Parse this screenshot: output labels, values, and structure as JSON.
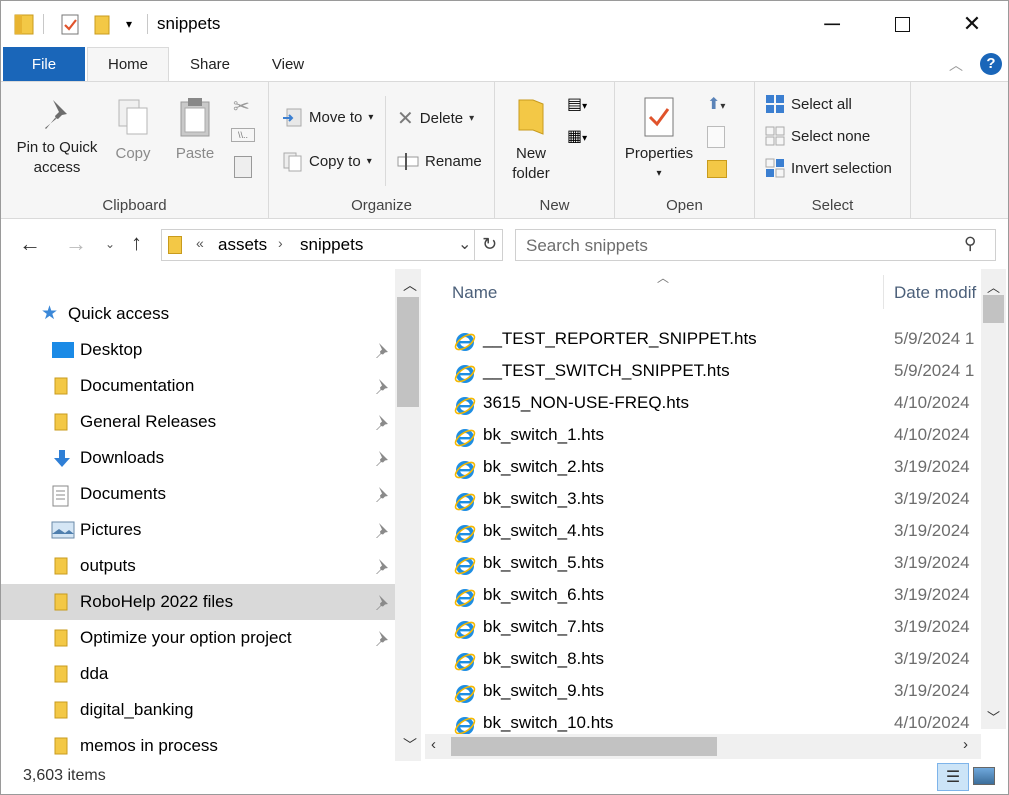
{
  "window": {
    "title": "snippets"
  },
  "tabs": [
    {
      "label": "File"
    },
    {
      "label": "Home"
    },
    {
      "label": "Share"
    },
    {
      "label": "View"
    }
  ],
  "ribbon": {
    "clipboard": {
      "group": "Clipboard",
      "pin": "Pin to Quick\naccess",
      "copy": "Copy",
      "paste": "Paste"
    },
    "organize": {
      "group": "Organize",
      "move_to": "Move to",
      "copy_to": "Copy to",
      "delete": "Delete",
      "rename": "Rename"
    },
    "new": {
      "group": "New",
      "new_folder": "New\nfolder"
    },
    "open": {
      "group": "Open",
      "properties": "Properties"
    },
    "select": {
      "group": "Select",
      "select_all": "Select all",
      "select_none": "Select none",
      "invert": "Invert selection"
    }
  },
  "address": {
    "overflow": "«",
    "crumbs": [
      "assets",
      "snippets"
    ]
  },
  "search": {
    "placeholder": "Search snippets"
  },
  "nav": {
    "quick_access": "Quick access",
    "items": [
      {
        "label": "Desktop",
        "icon": "desktop-icon",
        "pinned": true
      },
      {
        "label": "Documentation",
        "icon": "folder-icon",
        "pinned": true
      },
      {
        "label": "General Releases",
        "icon": "folder-icon",
        "pinned": true
      },
      {
        "label": "Downloads",
        "icon": "downloads-icon",
        "pinned": true
      },
      {
        "label": "Documents",
        "icon": "documents-icon",
        "pinned": true
      },
      {
        "label": "Pictures",
        "icon": "pictures-icon",
        "pinned": true
      },
      {
        "label": "outputs",
        "icon": "folder-icon",
        "pinned": true
      },
      {
        "label": "RoboHelp 2022 files",
        "icon": "folder-icon",
        "pinned": true
      },
      {
        "label": "Optimize your option project",
        "icon": "folder-icon",
        "pinned": true
      },
      {
        "label": "dda",
        "icon": "folder-icon",
        "pinned": false
      },
      {
        "label": "digital_banking",
        "icon": "folder-icon",
        "pinned": false
      },
      {
        "label": "memos in process",
        "icon": "folder-icon",
        "pinned": false
      }
    ]
  },
  "columns": {
    "name": "Name",
    "date": "Date modif"
  },
  "files": [
    {
      "name": "__TEST_REPORTER_SNIPPET.hts",
      "date": "5/9/2024 1"
    },
    {
      "name": "__TEST_SWITCH_SNIPPET.hts",
      "date": "5/9/2024 1"
    },
    {
      "name": "3615_NON-USE-FREQ.hts",
      "date": "4/10/2024"
    },
    {
      "name": "bk_switch_1.hts",
      "date": "4/10/2024"
    },
    {
      "name": "bk_switch_2.hts",
      "date": "3/19/2024"
    },
    {
      "name": "bk_switch_3.hts",
      "date": "3/19/2024"
    },
    {
      "name": "bk_switch_4.hts",
      "date": "3/19/2024"
    },
    {
      "name": "bk_switch_5.hts",
      "date": "3/19/2024"
    },
    {
      "name": "bk_switch_6.hts",
      "date": "3/19/2024"
    },
    {
      "name": "bk_switch_7.hts",
      "date": "3/19/2024"
    },
    {
      "name": "bk_switch_8.hts",
      "date": "3/19/2024"
    },
    {
      "name": "bk_switch_9.hts",
      "date": "3/19/2024"
    },
    {
      "name": "bk_switch_10.hts",
      "date": "4/10/2024"
    }
  ],
  "status": {
    "count": "3,603 items"
  },
  "colors": {
    "accent": "#1a66b9",
    "folder": "#f3c846",
    "selected": "#d9d9d9"
  }
}
